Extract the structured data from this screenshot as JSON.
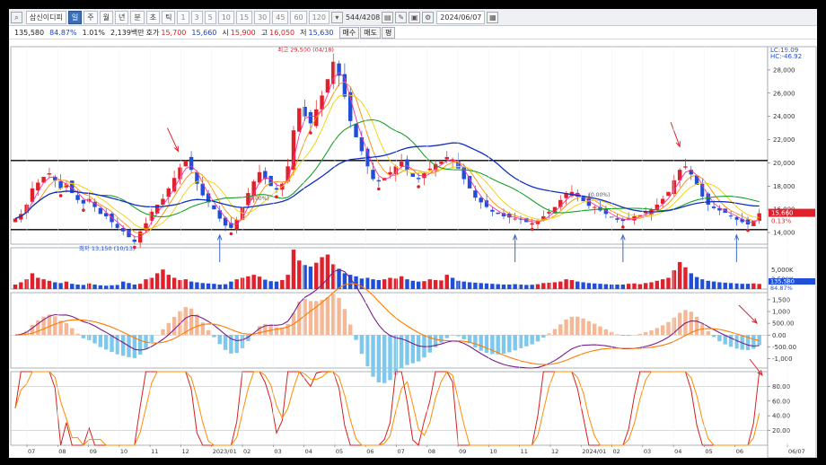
{
  "toolbar": {
    "stock_name": "삼신이디피",
    "periods": [
      "일",
      "주",
      "월",
      "년",
      "분",
      "초",
      "틱"
    ],
    "active_period": "일",
    "intervals": [
      "1",
      "3",
      "5",
      "10",
      "15",
      "30",
      "45",
      "60",
      "120"
    ],
    "count": "544/4208",
    "date": "2024/06/07"
  },
  "info": {
    "volume": "135,580",
    "pct": "84.87%",
    "turnover": "1.01%",
    "amount": "2,139백만",
    "bid_label": "호가",
    "bid_price": "15,700",
    "ask_price": "15,660",
    "open_label": "시",
    "open": "15,900",
    "high_label": "고",
    "high": "16,050",
    "low_label": "저",
    "low": "15,630",
    "buy_label": "매수",
    "sell_label": "매도",
    "eval_label": "평"
  },
  "colors": {
    "up": "#e0202a",
    "down": "#1f4fd8",
    "ma5": "#ff2fa0",
    "ma10": "#ff8c00",
    "ma20": "#f0d000",
    "ma60": "#1aa02a",
    "ma120": "#1030c0",
    "macd": "#7a1f8a",
    "signal": "#ff7a00",
    "stoch_k": "#d52020",
    "stoch_d": "#ff8c00",
    "hline": "#000000",
    "annot_arrow_red": "#e0202a",
    "annot_arrow_blue": "#3a68c8"
  },
  "chart_data": [
    {
      "type": "candlestick",
      "panel": "price",
      "y_ticks": [
        "28,000",
        "26,000",
        "24,000",
        "22,000",
        "20,000",
        "18,000",
        "16,000",
        "14,000"
      ],
      "ylim": [
        13000,
        30000
      ],
      "y_tick_values": [
        28000,
        26000,
        24000,
        22000,
        20000,
        18000,
        16000,
        14000
      ],
      "lc_label": "LC:19.09",
      "hc_label": "HC:-46.92",
      "current_price": "15,660",
      "current_change": "0.13%",
      "high_annotation": "최고 29,500 (04/18)",
      "low_annotation": "최저 13,150 (10/13)",
      "fib_label_1": "(0.00%)",
      "fib_label_2": "(0.00%)",
      "horizontal_lines": [
        20200,
        14250
      ],
      "close_series": [
        15200,
        15600,
        16400,
        17800,
        18300,
        18800,
        19100,
        18500,
        17800,
        18200,
        17400,
        16800,
        16500,
        16900,
        16200,
        15600,
        15400,
        14900,
        14400,
        14100,
        13600,
        13200,
        14100,
        14800,
        15800,
        16400,
        16900,
        17800,
        18700,
        19600,
        20200,
        19400,
        18200,
        17200,
        16600,
        16000,
        15200,
        14600,
        14400,
        15100,
        16200,
        17400,
        18400,
        19200,
        18600,
        18000,
        17700,
        18200,
        19700,
        22800,
        24700,
        24000,
        23400,
        24600,
        25800,
        27200,
        28700,
        27500,
        25700,
        23600,
        22200,
        21000,
        19700,
        18600,
        18400,
        18700,
        19200,
        19700,
        20100,
        19400,
        18800,
        18600,
        19100,
        19500,
        19900,
        20100,
        20500,
        20300,
        19500,
        18600,
        17800,
        17000,
        16600,
        16200,
        15800,
        15600,
        15400,
        15300,
        15200,
        15100,
        14900,
        14800,
        15000,
        15400,
        15800,
        16200,
        16800,
        17400,
        17500,
        17100,
        16700,
        16300,
        16200,
        15900,
        15600,
        15300,
        15100,
        15000,
        15200,
        15400,
        15500,
        15800,
        16000,
        16400,
        16900,
        17500,
        18500,
        19400,
        19700,
        19000,
        18100,
        17100,
        16400,
        16100,
        15900,
        15700,
        15400,
        15100,
        14900,
        14700,
        15000,
        15660
      ],
      "volume_ylabels": [
        "5,000K",
        "2,500K"
      ],
      "volume_last": "135,580",
      "volume_last_pct": "84.87%",
      "volume_series": [
        120,
        180,
        260,
        420,
        300,
        260,
        220,
        180,
        160,
        200,
        140,
        120,
        110,
        150,
        120,
        100,
        90,
        100,
        110,
        200,
        160,
        120,
        140,
        260,
        300,
        420,
        520,
        380,
        300,
        240,
        260,
        200,
        180,
        160,
        150,
        140,
        120,
        130,
        200,
        260,
        300,
        340,
        380,
        330,
        250,
        210,
        200,
        240,
        380,
        1050,
        760,
        640,
        600,
        700,
        850,
        920,
        660,
        540,
        420,
        380,
        340,
        280,
        300,
        260,
        240,
        260,
        300,
        280,
        340,
        260,
        220,
        200,
        210,
        260,
        240,
        230,
        380,
        300,
        220,
        200,
        180,
        170,
        160,
        150,
        140,
        130,
        120,
        120,
        130,
        120,
        110,
        115,
        130,
        160,
        170,
        180,
        200,
        260,
        240,
        200,
        180,
        160,
        150,
        140,
        130,
        120,
        120,
        120,
        140,
        150,
        130,
        160,
        180,
        220,
        260,
        300,
        500,
        720,
        580,
        420,
        320,
        260,
        220,
        200,
        180,
        170,
        160,
        150,
        140,
        140,
        150,
        136
      ]
    },
    {
      "type": "line",
      "panel": "macd",
      "y_ticks": [
        "1,500",
        "1,000",
        "500.00",
        "0.00",
        "-500.00",
        "-1,000"
      ],
      "y_tick_values": [
        1500,
        1000,
        500,
        0,
        -500,
        -1000
      ],
      "ylim": [
        -1400,
        1800
      ]
    },
    {
      "type": "line",
      "panel": "stochastic",
      "y_ticks": [
        "80.00",
        "60.00",
        "40.00",
        "20.00"
      ],
      "y_tick_values": [
        80,
        60,
        40,
        20
      ],
      "ylim": [
        0,
        100
      ]
    }
  ],
  "x_axis": {
    "labels": [
      "07",
      "08",
      "09",
      "10",
      "11",
      "12",
      "2023/01",
      "02",
      "03",
      "04",
      "05",
      "06",
      "07",
      "08",
      "09",
      "10",
      "11",
      "12",
      "2024/01",
      "02",
      "03",
      "04",
      "05",
      "06",
      "06/07"
    ]
  }
}
